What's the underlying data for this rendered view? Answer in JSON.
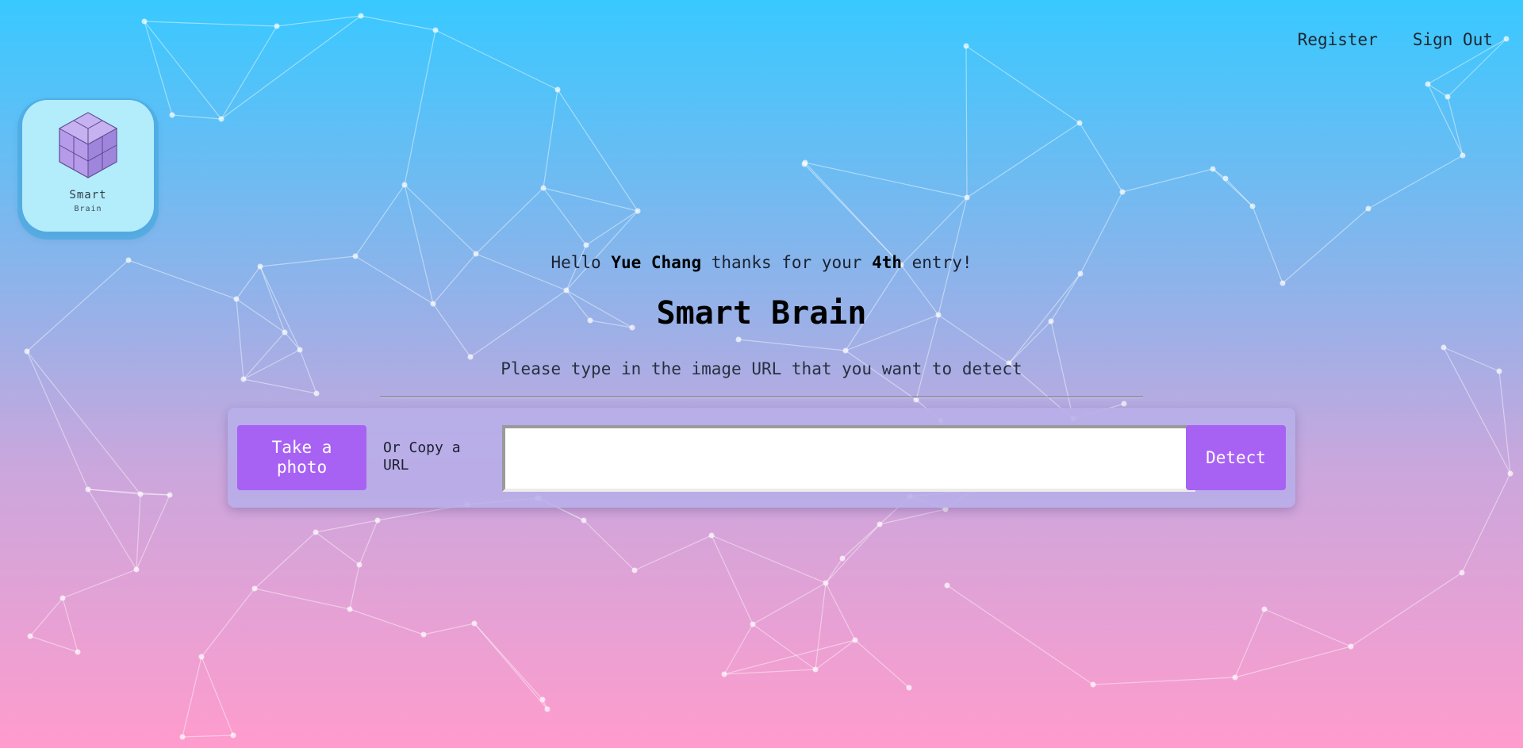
{
  "nav": {
    "register": "Register",
    "sign_out": "Sign Out"
  },
  "logo": {
    "title": "Smart",
    "subtitle": "Brain",
    "icon": "isometric-cube-icon"
  },
  "greeting": {
    "prefix": "Hello ",
    "name": "Yue Chang",
    "middle": " thanks for your ",
    "count": "4th",
    "suffix": " entry!"
  },
  "page": {
    "title": "Smart Brain",
    "instruction": "Please type in the image URL that you want to detect"
  },
  "form": {
    "photo_button": "Take a photo",
    "or_copy_label": "Or Copy a URL",
    "url_value": "",
    "url_placeholder": "",
    "detect_button": "Detect"
  },
  "colors": {
    "accent": "#a862f3",
    "gradient_top": "#38c9ff",
    "gradient_bottom": "#ff9ccd",
    "logo_bg": "#b3ecfb"
  }
}
